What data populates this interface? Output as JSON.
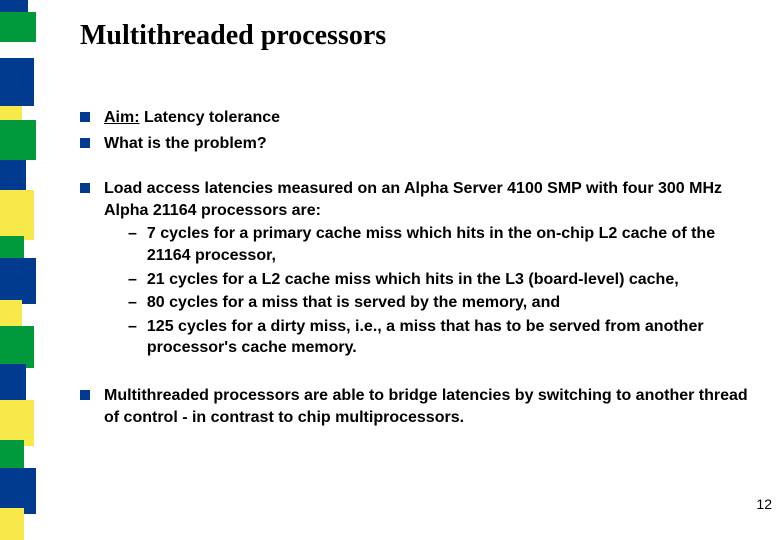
{
  "title": "Multithreaded processors",
  "group1": {
    "b0_prefix": "Aim:",
    "b0_rest": " Latency tolerance",
    "b1": "What is the problem?"
  },
  "group2": {
    "lead": "Load access latencies measured on an Alpha Server 4100 SMP with four 300 MHz Alpha 21164 processors are:",
    "s0": "7 cycles for a primary cache miss which hits in the on-chip L2 cache of the 21164 processor,",
    "s1": "21 cycles for a L2 cache miss which hits in the L3 (board-level) cache,",
    "s2": "80 cycles for a miss that is served by the memory, and",
    "s3": "125 cycles for a dirty miss, i.e., a miss that has to be served from another processor's cache memory."
  },
  "group3": {
    "b0": "Multithreaded processors are able to bridge latencies by switching to another thread of control - in contrast to chip multiprocessors."
  },
  "dash": "–",
  "page_number": "12"
}
